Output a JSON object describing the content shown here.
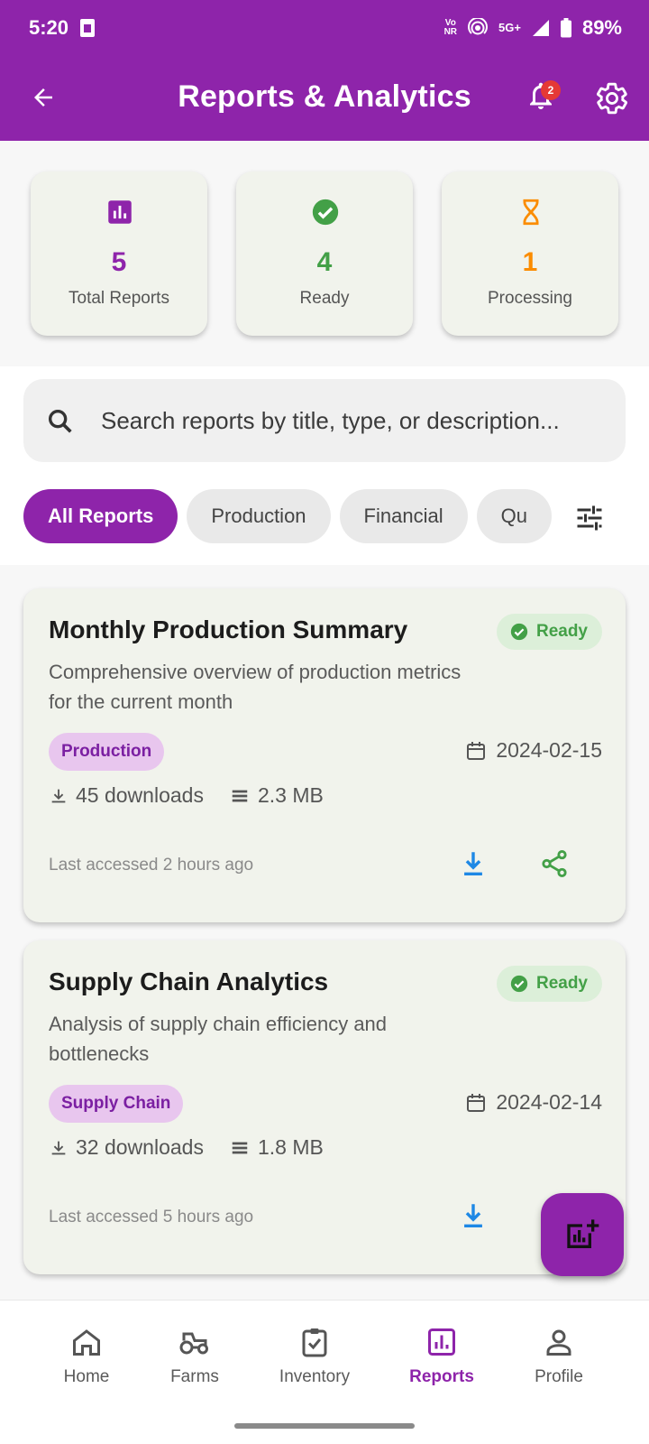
{
  "status_bar": {
    "time": "5:20",
    "network_top": "Vo",
    "network_bottom": "NR",
    "signal_label": "5G+",
    "battery": "89%"
  },
  "app_bar": {
    "title": "Reports & Analytics",
    "notification_count": "2"
  },
  "stats": [
    {
      "value": "5",
      "label": "Total Reports",
      "icon": "bar-chart-icon",
      "color": "#8e24aa"
    },
    {
      "value": "4",
      "label": "Ready",
      "icon": "check-circle-icon",
      "color": "#43a047"
    },
    {
      "value": "1",
      "label": "Processing",
      "icon": "hourglass-icon",
      "color": "#fb8c00"
    }
  ],
  "search": {
    "placeholder": "Search reports by title, type, or description..."
  },
  "filters": {
    "chips": [
      "All Reports",
      "Production",
      "Financial",
      "Qu"
    ],
    "active": "All Reports"
  },
  "reports": [
    {
      "title": "Monthly Production Summary",
      "status": "Ready",
      "description": "Comprehensive overview of production metrics for the current month",
      "category": "Production",
      "date": "2024-02-15",
      "downloads": "45 downloads",
      "size": "2.3 MB",
      "last_accessed": "Last accessed 2 hours ago"
    },
    {
      "title": "Supply Chain Analytics",
      "status": "Ready",
      "description": "Analysis of supply chain efficiency and bottlenecks",
      "category": "Supply Chain",
      "date": "2024-02-14",
      "downloads": "32 downloads",
      "size": "1.8 MB",
      "last_accessed": "Last accessed 5 hours ago"
    }
  ],
  "bottom_nav": {
    "items": [
      {
        "label": "Home",
        "icon": "home-icon"
      },
      {
        "label": "Farms",
        "icon": "tractor-icon"
      },
      {
        "label": "Inventory",
        "icon": "clipboard-check-icon"
      },
      {
        "label": "Reports",
        "icon": "bar-chart-icon"
      },
      {
        "label": "Profile",
        "icon": "person-icon"
      }
    ],
    "active": "Reports"
  },
  "colors": {
    "primary": "#8e24aa",
    "ready": "#43a047",
    "processing": "#fb8c00",
    "download": "#1e88e5",
    "share": "#43a047"
  }
}
